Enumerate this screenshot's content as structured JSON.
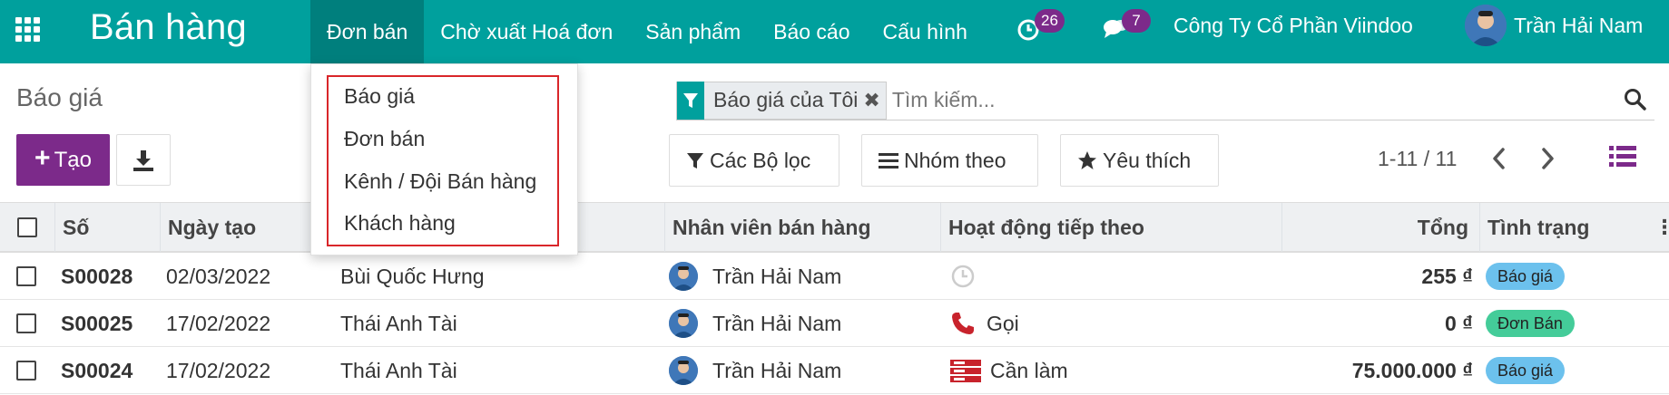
{
  "app": {
    "brand": "Bán hàng",
    "menu": [
      "Đơn bán",
      "Chờ xuất Hoá đơn",
      "Sản phẩm",
      "Báo cáo",
      "Cấu hình"
    ],
    "activity_count": "26",
    "message_count": "7",
    "company": "Công Ty Cổ Phần Viindoo",
    "user": "Trần Hải Nam",
    "accent_color": "#00a09d",
    "primary_color": "#7c2a8a"
  },
  "dropdown": {
    "items": [
      "Báo giá",
      "Đơn bán",
      "Kênh / Đội Bán hàng",
      "Khách hàng"
    ],
    "highlight_color": "#d9262a"
  },
  "control": {
    "breadcrumb": "Báo giá",
    "create_label": "Tạo",
    "facet": "Báo giá của Tôi",
    "search_placeholder": "Tìm kiếm...",
    "filters_label": "Các Bộ lọc",
    "group_by_label": "Nhóm theo",
    "favorites_label": "Yêu thích",
    "pager": "1-11 / 11"
  },
  "table": {
    "columns": [
      "Số",
      "Ngày tạo",
      "Nhân viên bán hàng",
      "Hoạt động tiếp theo",
      "Tổng",
      "Tình trạng"
    ],
    "rows": [
      {
        "number": "S00028",
        "date": "02/03/2022",
        "customer": "Bùi Quốc Hưng",
        "salesperson": "Trần Hải Nam",
        "activity_icon": "clock-icon",
        "activity": "",
        "total": "255 ₫",
        "status": "Báo giá",
        "status_color": "#6cc1ed"
      },
      {
        "number": "S00025",
        "date": "17/02/2022",
        "customer": "Thái Anh Tài",
        "salesperson": "Trần Hải Nam",
        "activity_icon": "phone-icon",
        "activity": "Gọi",
        "total": "0 ₫",
        "status": "Đơn Bán",
        "status_color": "#44cc99"
      },
      {
        "number": "S00024",
        "date": "17/02/2022",
        "customer": "Thái Anh Tài",
        "salesperson": "Trần Hải Nam",
        "activity_icon": "tasks-icon",
        "activity": "Cần làm",
        "total": "75.000.000 ₫",
        "status": "Báo giá",
        "status_color": "#6cc1ed"
      }
    ]
  }
}
